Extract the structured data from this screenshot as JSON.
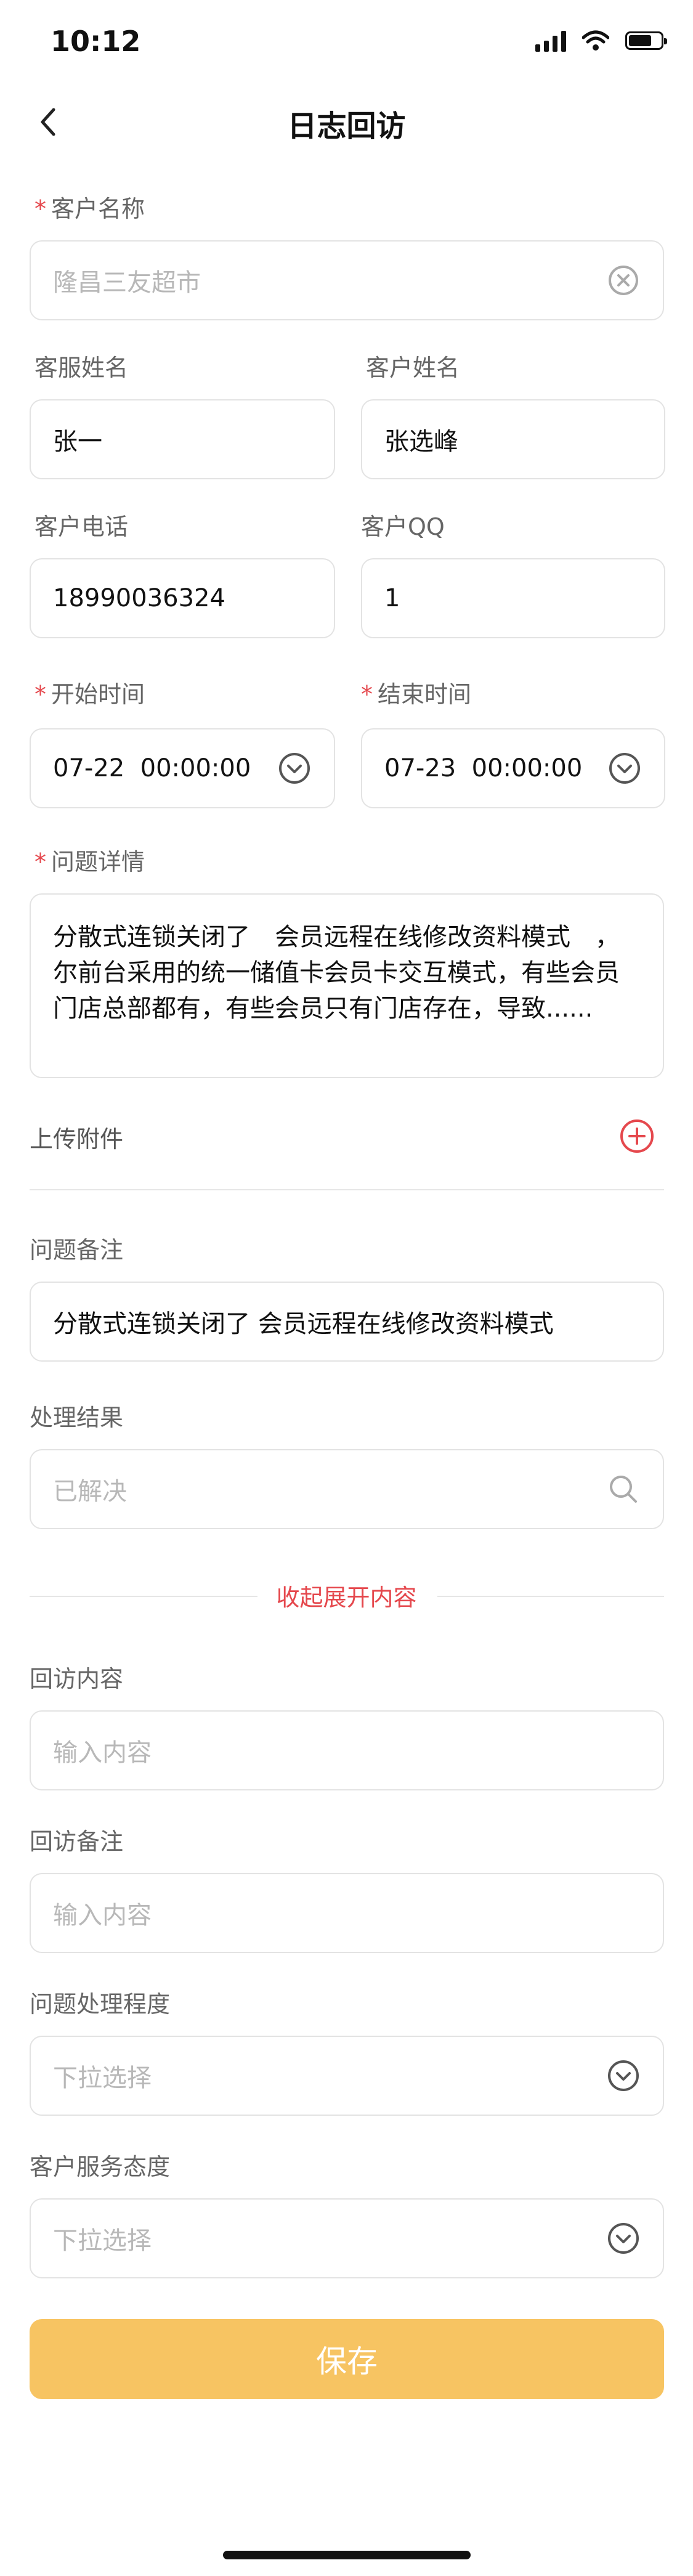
{
  "status": {
    "time": "10:12"
  },
  "header": {
    "title": "日志回访"
  },
  "required_mark": "*",
  "form": {
    "customer_name": {
      "label": "客户名称",
      "value": "隆昌三友超市"
    },
    "service_name": {
      "label": "客服姓名",
      "value": "张一"
    },
    "customer_person": {
      "label": "客户姓名",
      "value": "张选峰"
    },
    "customer_phone": {
      "label": "客户电话",
      "value": "18990036324"
    },
    "customer_qq": {
      "label": "客户QQ",
      "value": "1"
    },
    "start_time": {
      "label": "开始时间",
      "value": "07-22  00:00:00"
    },
    "end_time": {
      "label": "结束时间",
      "value": "07-23  00:00:00"
    },
    "issue_detail": {
      "label": "问题详情",
      "value": "分散式连锁关闭了　会员远程在线修改资料模式　，尔前台采用的统一储值卡会员卡交互模式，有些会员门店总部都有，有些会员只有门店存在，导致......"
    },
    "attachment": {
      "label": "上传附件"
    },
    "issue_note": {
      "label": "问题备注",
      "value": "分散式连锁关闭了 会员远程在线修改资料模式"
    },
    "result": {
      "label": "处理结果",
      "placeholder": "已解决"
    },
    "collapse_text": "收起展开内容",
    "visit_content": {
      "label": "回访内容",
      "placeholder": "输入内容"
    },
    "visit_note": {
      "label": "回访备注",
      "placeholder": "输入内容"
    },
    "handling_degree": {
      "label": "问题处理程度",
      "placeholder": "下拉选择"
    },
    "service_attitude": {
      "label": "客户服务态度",
      "placeholder": "下拉选择"
    }
  },
  "actions": {
    "save_label": "保存"
  },
  "colors": {
    "accent": "#f7c462",
    "required": "#e5484d",
    "add_icon": "#e5484d",
    "link": "#e5484d"
  }
}
